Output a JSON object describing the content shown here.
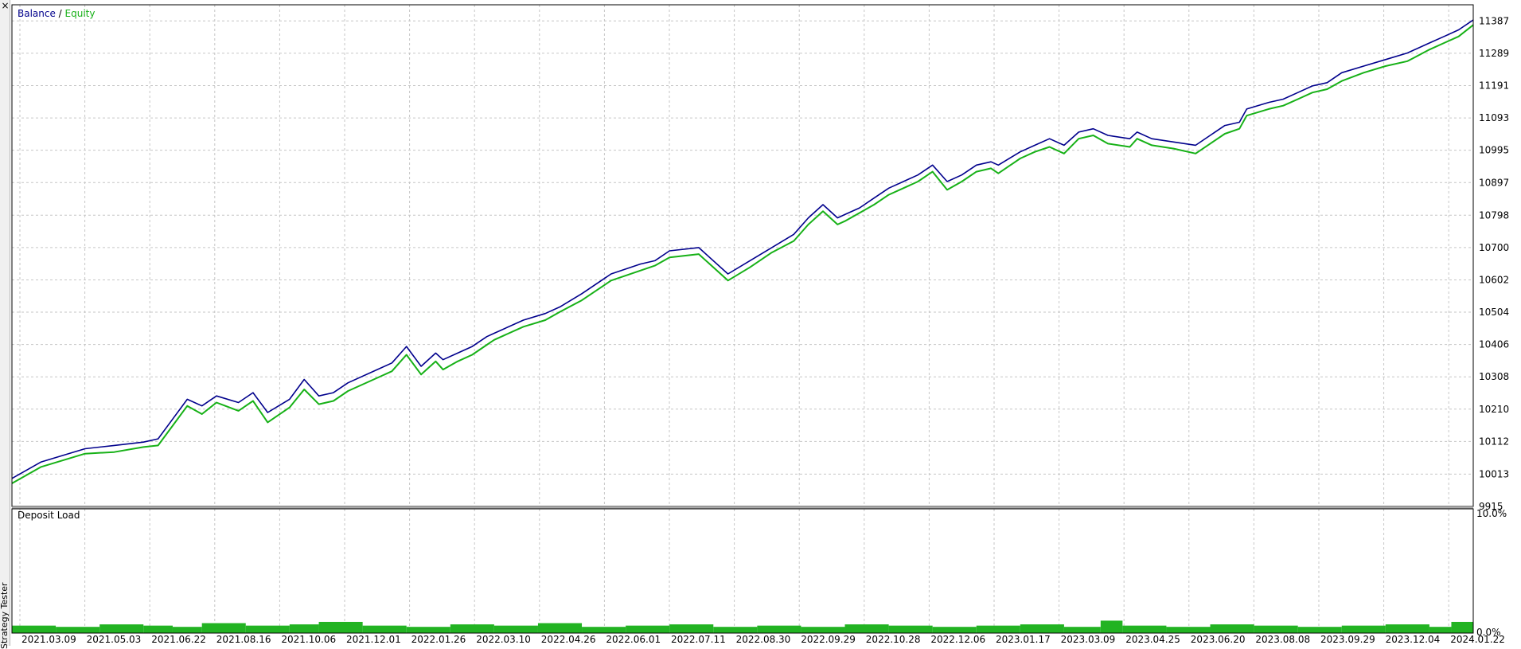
{
  "app": {
    "side_label": "Strategy Tester",
    "close_glyph": "×"
  },
  "colors": {
    "balance": "#00008c",
    "equity": "#17b117",
    "deposit_load": "#22b322",
    "grid": "#c6c6c6",
    "frame": "#000000"
  },
  "chart_data": [
    {
      "type": "line",
      "legend": {
        "entries": [
          "Balance",
          "Equity"
        ],
        "separator": " / ",
        "placement": "top-left"
      },
      "ylim": [
        9915,
        11436
      ],
      "yticks": [
        10013,
        10112,
        10210,
        10308,
        10406,
        10504,
        10602,
        10700,
        10798,
        10897,
        10995,
        11093,
        11191,
        11289,
        11387
      ],
      "ytick_labels": [
        "10013",
        "10112",
        "10210",
        "10308",
        "10406",
        "10504",
        "10602",
        "10700",
        "10798",
        "10897",
        "10995",
        "11093",
        "11191",
        "11289",
        "11387"
      ],
      "ymin_label": "9915",
      "grid": true,
      "series": [
        {
          "name": "Balance",
          "x": [
            0,
            0.02,
            0.05,
            0.07,
            0.09,
            0.1,
            0.11,
            0.12,
            0.13,
            0.14,
            0.155,
            0.165,
            0.175,
            0.19,
            0.2,
            0.21,
            0.22,
            0.23,
            0.25,
            0.26,
            0.27,
            0.28,
            0.29,
            0.295,
            0.305,
            0.315,
            0.325,
            0.33,
            0.35,
            0.365,
            0.375,
            0.39,
            0.41,
            0.43,
            0.44,
            0.45,
            0.47,
            0.49,
            0.505,
            0.52,
            0.535,
            0.545,
            0.555,
            0.565,
            0.57,
            0.58,
            0.59,
            0.6,
            0.61,
            0.62,
            0.63,
            0.64,
            0.65,
            0.66,
            0.67,
            0.675,
            0.69,
            0.7,
            0.71,
            0.72,
            0.73,
            0.74,
            0.75,
            0.765,
            0.77,
            0.78,
            0.795,
            0.81,
            0.82,
            0.83,
            0.84,
            0.845,
            0.86,
            0.87,
            0.88,
            0.89,
            0.9,
            0.91,
            0.925,
            0.94,
            0.955,
            0.97,
            0.98,
            0.99,
            1.0
          ],
          "y": [
            10000,
            10050,
            10090,
            10100,
            10110,
            10120,
            10180,
            10240,
            10220,
            10250,
            10230,
            10260,
            10200,
            10240,
            10300,
            10250,
            10260,
            10290,
            10330,
            10350,
            10400,
            10340,
            10380,
            10360,
            10380,
            10400,
            10430,
            10440,
            10480,
            10500,
            10520,
            10560,
            10620,
            10650,
            10660,
            10690,
            10700,
            10620,
            10660,
            10700,
            10740,
            10790,
            10830,
            10790,
            10800,
            10820,
            10850,
            10880,
            10900,
            10920,
            10950,
            10900,
            10920,
            10950,
            10960,
            10950,
            10990,
            11010,
            11030,
            11010,
            11050,
            11060,
            11040,
            11030,
            11050,
            11030,
            11020,
            11010,
            11040,
            11070,
            11080,
            11120,
            11140,
            11150,
            11170,
            11190,
            11200,
            11230,
            11250,
            11270,
            11290,
            11320,
            11340,
            11360,
            11390
          ]
        },
        {
          "name": "Equity",
          "x": [
            0,
            0.02,
            0.05,
            0.07,
            0.09,
            0.1,
            0.11,
            0.12,
            0.13,
            0.14,
            0.155,
            0.165,
            0.175,
            0.19,
            0.2,
            0.21,
            0.22,
            0.23,
            0.25,
            0.26,
            0.27,
            0.28,
            0.29,
            0.295,
            0.305,
            0.315,
            0.325,
            0.33,
            0.35,
            0.365,
            0.375,
            0.39,
            0.41,
            0.43,
            0.44,
            0.45,
            0.47,
            0.49,
            0.505,
            0.52,
            0.535,
            0.545,
            0.555,
            0.565,
            0.57,
            0.58,
            0.59,
            0.6,
            0.61,
            0.62,
            0.63,
            0.64,
            0.65,
            0.66,
            0.67,
            0.675,
            0.69,
            0.7,
            0.71,
            0.72,
            0.73,
            0.74,
            0.75,
            0.765,
            0.77,
            0.78,
            0.795,
            0.81,
            0.82,
            0.83,
            0.84,
            0.845,
            0.86,
            0.87,
            0.88,
            0.89,
            0.9,
            0.91,
            0.925,
            0.94,
            0.955,
            0.97,
            0.98,
            0.99,
            1.0
          ],
          "y": [
            9985,
            10035,
            10075,
            10080,
            10095,
            10100,
            10160,
            10220,
            10195,
            10230,
            10205,
            10235,
            10170,
            10215,
            10270,
            10225,
            10235,
            10265,
            10305,
            10325,
            10375,
            10315,
            10355,
            10330,
            10355,
            10375,
            10405,
            10420,
            10460,
            10480,
            10505,
            10540,
            10600,
            10630,
            10645,
            10670,
            10680,
            10600,
            10640,
            10685,
            10720,
            10770,
            10810,
            10770,
            10780,
            10805,
            10830,
            10860,
            10880,
            10900,
            10930,
            10875,
            10900,
            10930,
            10940,
            10925,
            10970,
            10990,
            11005,
            10985,
            11030,
            11040,
            11015,
            11005,
            11030,
            11010,
            11000,
            10985,
            11015,
            11045,
            11060,
            11100,
            11120,
            11130,
            11150,
            11170,
            11180,
            11205,
            11230,
            11250,
            11265,
            11300,
            11320,
            11340,
            11375
          ]
        }
      ]
    },
    {
      "type": "bar",
      "title": "Deposit Load",
      "ylim": [
        0,
        10.0
      ],
      "ytick_labels": [
        "10.0%",
        "0.0%"
      ],
      "grid": true,
      "x_labels": [
        "2021.03.09",
        "2021.05.03",
        "2021.06.22",
        "2021.08.16",
        "2021.10.06",
        "2021.12.01",
        "2022.01.26",
        "2022.03.10",
        "2022.04.26",
        "2022.06.01",
        "2022.07.11",
        "2022.08.30",
        "2022.09.29",
        "2022.10.28",
        "2022.12.06",
        "2023.01.17",
        "2023.03.09",
        "2023.04.25",
        "2023.06.20",
        "2023.08.08",
        "2023.09.29",
        "2023.12.04",
        "2024.01.22"
      ],
      "series": [
        {
          "name": "Deposit Load",
          "x": [
            0,
            0.03,
            0.06,
            0.09,
            0.11,
            0.13,
            0.16,
            0.19,
            0.21,
            0.24,
            0.27,
            0.3,
            0.33,
            0.36,
            0.39,
            0.42,
            0.45,
            0.48,
            0.51,
            0.54,
            0.57,
            0.6,
            0.63,
            0.66,
            0.69,
            0.72,
            0.745,
            0.76,
            0.79,
            0.82,
            0.85,
            0.88,
            0.91,
            0.94,
            0.97,
            0.985,
            1.0
          ],
          "y": [
            0.6,
            0.5,
            0.7,
            0.6,
            0.5,
            0.8,
            0.6,
            0.7,
            0.9,
            0.6,
            0.5,
            0.7,
            0.6,
            0.8,
            0.5,
            0.6,
            0.7,
            0.5,
            0.6,
            0.5,
            0.7,
            0.6,
            0.5,
            0.6,
            0.7,
            0.5,
            1.0,
            0.6,
            0.5,
            0.7,
            0.6,
            0.5,
            0.6,
            0.7,
            0.5,
            0.9,
            0.6
          ]
        }
      ]
    }
  ]
}
